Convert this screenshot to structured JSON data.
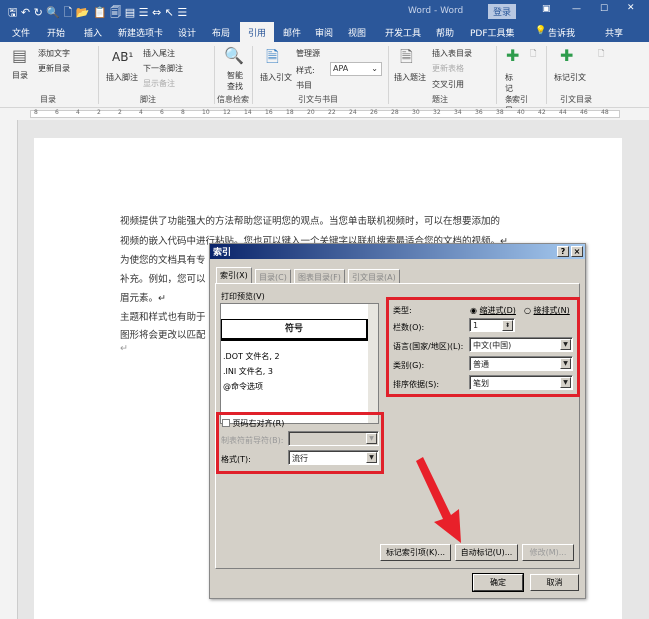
{
  "titlebar": {
    "title": "Word - Word",
    "login": "登录"
  },
  "tabs": [
    "文件",
    "开始",
    "插入",
    "新建选项卡",
    "设计",
    "布局",
    "引用",
    "邮件",
    "审阅",
    "视图",
    "开发工具",
    "帮助",
    "PDF工具集",
    "告诉我",
    "共享"
  ],
  "ribbon": {
    "toc": {
      "label": "目录",
      "add_text": "添加文字",
      "update": "更新目录",
      "group": "目录"
    },
    "footnote": {
      "insert": "插入脚注",
      "endnote": "插入尾注",
      "next": "下一条脚注",
      "show": "显示备注",
      "group": "脚注"
    },
    "research": {
      "smart": "智能查找",
      "group": "信息检索"
    },
    "citation": {
      "insert": "插入引文",
      "manage": "管理源",
      "style_label": "样式:",
      "style_value": "APA",
      "biblio": "书目",
      "group": "引文与书目"
    },
    "caption": {
      "insert": "插入题注",
      "table_fig": "插入表目录",
      "update": "更新表格",
      "cross": "交叉引用",
      "group": "题注"
    },
    "index": {
      "mark": "标记条目",
      "group": "索引"
    },
    "toa": {
      "mark": "标记引文",
      "group": "引文目录"
    }
  },
  "ruler": [
    "8",
    "6",
    "4",
    "2",
    "2",
    "4",
    "6",
    "8",
    "10",
    "12",
    "14",
    "16",
    "18",
    "20",
    "22",
    "24",
    "26",
    "28",
    "30",
    "32",
    "34",
    "36",
    "38",
    "40",
    "42",
    "44",
    "46",
    "48"
  ],
  "document": {
    "lines": [
      "视频提供了功能强大的方法帮助您证明您的观点。当您单击联机视频时，可以在想要添加的",
      "视频的嵌入代码中进行粘贴。您也可以键入一个关键字以联机搜索最适合您的文档的视频。↵",
      "为使您的文档具有专",
      "补充。例如，您可以",
      "眉元素。↵",
      "主题和样式也有助于",
      "图形将会更改以匹配",
      "↵"
    ]
  },
  "dialog": {
    "title": "索引",
    "help": "?",
    "close": "×",
    "tabs": [
      "索引(X)",
      "目录(C)",
      "图表目录(F)",
      "引文目录(A)"
    ],
    "preview_label": "打印预览(V)",
    "preview": {
      "heading": "符号",
      "entries": [
        ".DOT 文件名, 2",
        ".INI 文件名, 3",
        "@命令选项"
      ]
    },
    "type_label": "类型:",
    "type_options": [
      "缩进式(D)",
      "接排式(N)"
    ],
    "type_selected": "缩进式(D)",
    "columns_label": "栏数(O):",
    "columns_value": "1",
    "language_label": "语言(国家/地区)(L):",
    "language_value": "中文(中国)",
    "category_label": "类别(G):",
    "category_value": "普通",
    "sort_label": "排序依据(S):",
    "sort_value": "笔划",
    "right_align_label": "页码右对齐(R)",
    "right_align_checked": false,
    "leader_label": "制表符前导符(B):",
    "leader_value": "",
    "format_label": "格式(T):",
    "format_value": "流行",
    "buttons": {
      "mark_entry": "标记索引项(K)...",
      "automark": "自动标记(U)...",
      "modify": "修改(M)...",
      "ok": "确定",
      "cancel": "取消"
    }
  },
  "colors": {
    "brand": "#2b579a",
    "highlight": "#e0202a"
  }
}
